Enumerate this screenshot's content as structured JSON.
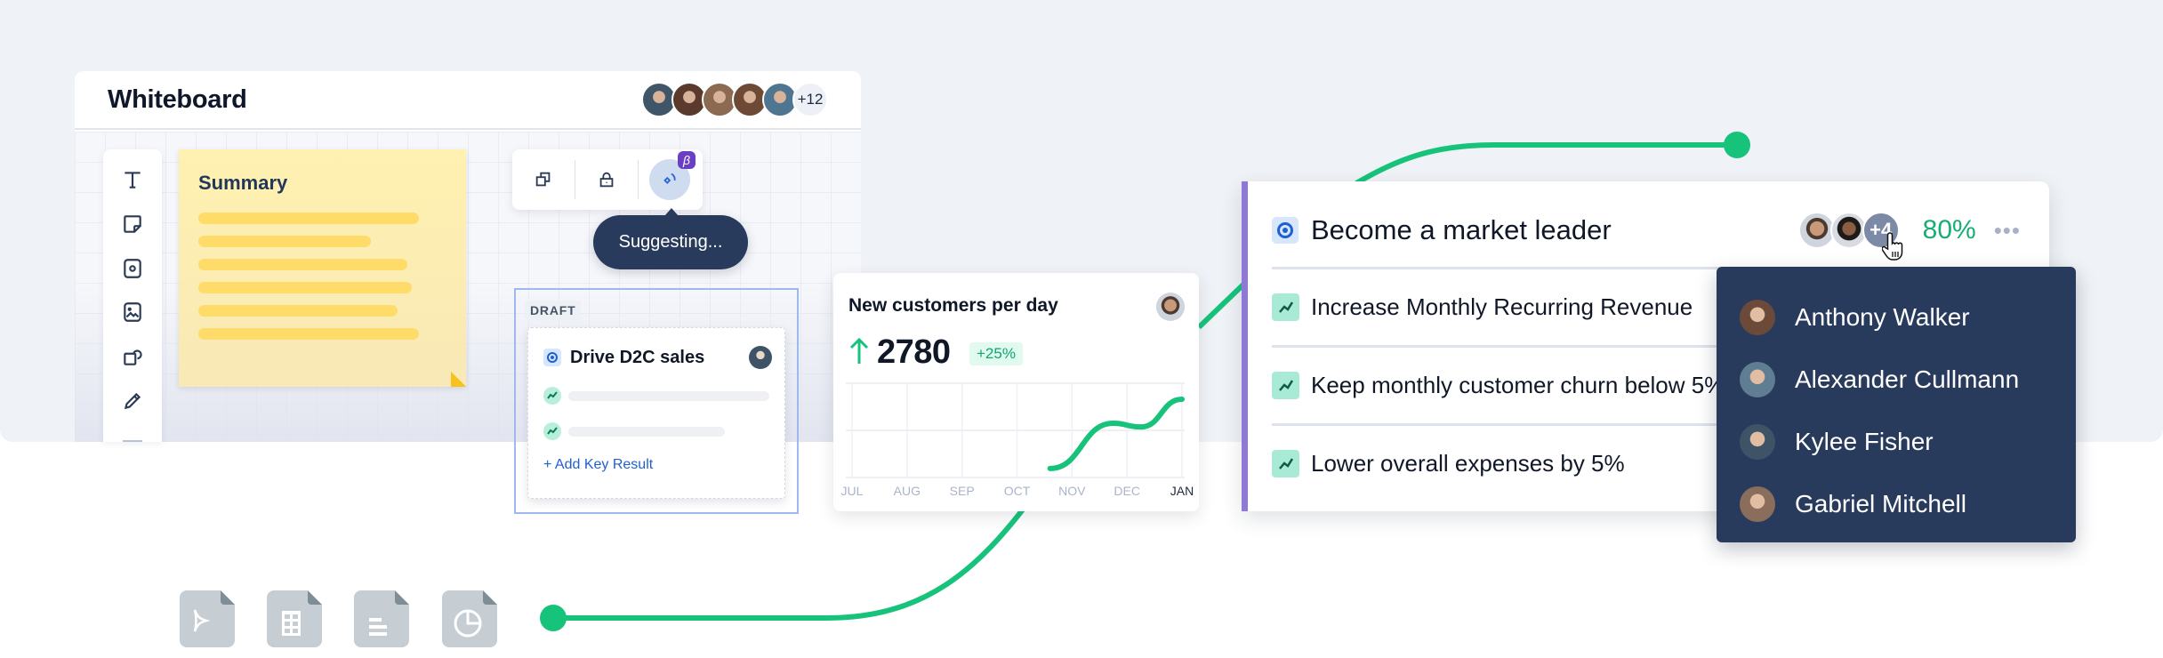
{
  "whiteboard": {
    "title": "Whiteboard",
    "collaborators_more": "+12",
    "collaborator_colors": [
      "#3f5568",
      "#5a3a2c",
      "#8c6a52",
      "#6e4a36",
      "#4e7690"
    ]
  },
  "tools": [
    {
      "name": "text-tool",
      "icon": "text-icon"
    },
    {
      "name": "sticky-note-tool",
      "icon": "sticky-note-icon"
    },
    {
      "name": "goal-tool",
      "icon": "goal-icon"
    },
    {
      "name": "image-tool",
      "icon": "image-icon"
    },
    {
      "name": "shapes-tool",
      "icon": "shapes-icon"
    },
    {
      "name": "pen-tool",
      "icon": "pen-icon"
    }
  ],
  "sticky": {
    "title": "Summary",
    "line_fractions": [
      0.92,
      0.72,
      0.87,
      0.89,
      0.83,
      0.92
    ]
  },
  "toolbar": {
    "buttons": [
      "duplicate",
      "lock",
      "ai-suggest"
    ],
    "beta_label": "β",
    "tooltip": "Suggesting..."
  },
  "draft": {
    "tag": "DRAFT",
    "title": "Drive D2C sales",
    "placeholder_fractions": [
      1.0,
      0.78
    ],
    "add_label": "+ Add Key Result"
  },
  "chart_card": {
    "title": "New customers per day",
    "value": "2780",
    "change": "+25%",
    "colors": {
      "line": "#17c37b",
      "grid": "#eef0f5",
      "tick": "#aab4c8",
      "tick_active": "#1e293b"
    }
  },
  "chart_data": {
    "type": "line",
    "title": "New customers per day",
    "categories": [
      "JUL",
      "AUG",
      "SEP",
      "OCT",
      "NOV",
      "DEC",
      "JAN"
    ],
    "active_category": "JAN",
    "series": [
      {
        "name": "New customers",
        "x": [
          3.6,
          4.75,
          5.25,
          6.0
        ],
        "y": [
          0.05,
          0.67,
          0.62,
          1.0
        ]
      }
    ],
    "ylim": [
      0,
      1
    ],
    "grid": true,
    "xlabel": "",
    "ylabel": ""
  },
  "goal": {
    "title": "Become a market leader",
    "owners_more": "+4",
    "progress": "80%",
    "menu": "•••",
    "key_results": [
      "Increase Monthly Recurring Revenue",
      "Keep monthly customer churn below 5%",
      "Lower overall expenses by 5%"
    ]
  },
  "owners_dropdown": [
    {
      "name": "Anthony Walker",
      "color": "#6b4a3a"
    },
    {
      "name": "Alexander Cullmann",
      "color": "#5f7d93"
    },
    {
      "name": "Kylee Fisher",
      "color": "#3e5466"
    },
    {
      "name": "Gabriel Mitchell",
      "color": "#8a6d5a"
    }
  ],
  "file_types": [
    "presentation-file-icon",
    "spreadsheet-file-icon",
    "document-file-icon",
    "chart-file-icon"
  ],
  "accent": {
    "green": "#17c37b",
    "navy": "#293b5c",
    "purple": "#8f78d8",
    "blue": "#1e5fd6"
  }
}
